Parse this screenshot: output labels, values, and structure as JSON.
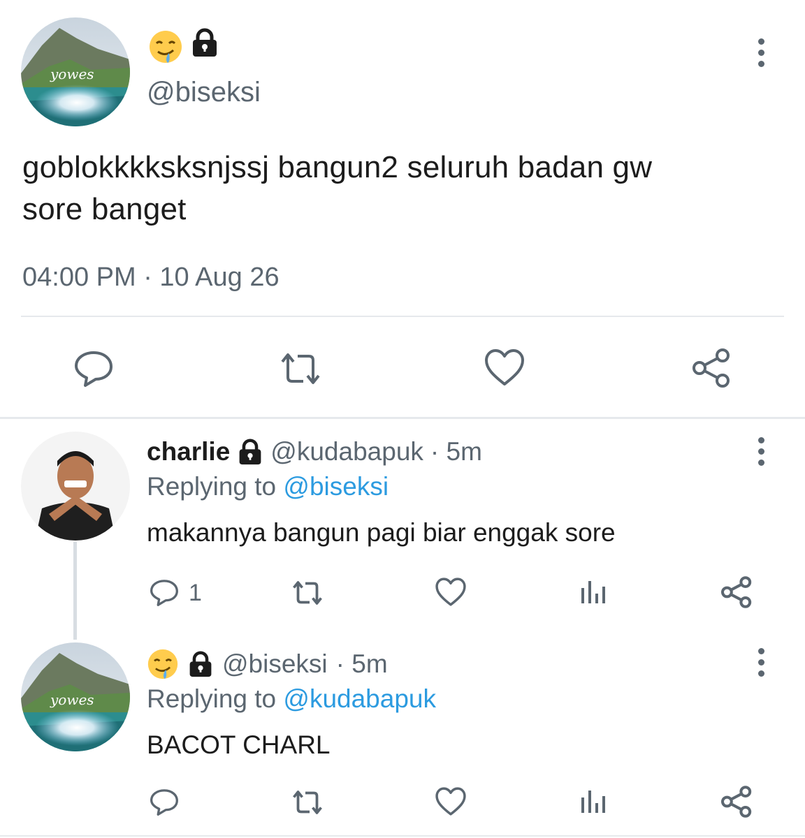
{
  "main_tweet": {
    "avatar_text": "yowes",
    "handle": "@biseksi",
    "text_line1": "goblokkkksksnjssj bangun2 seluruh badan gw",
    "text_line2": "sore banget",
    "timestamp": "04:00 PM · 10 Aug 26",
    "emoji_icon": "drooling-face-icon",
    "lock_icon": "lock-icon"
  },
  "replies": [
    {
      "name": "charlie",
      "handle": "@kudabapuk",
      "time": "· 5m",
      "replying_prefix": "Replying to",
      "replying_to": "@biseksi",
      "text": "makannya bangun pagi biar enggak sore",
      "reply_count": "1"
    },
    {
      "name": "",
      "handle": "@biseksi",
      "time": "· 5m",
      "replying_prefix": "Replying to",
      "replying_to": "@kudabapuk",
      "text": "BACOT CHARL",
      "reply_count": "",
      "avatar_text": "yowes"
    }
  ],
  "colors": {
    "text": "#1c1c1c",
    "muted": "#5b6670",
    "link": "#2c9be0",
    "divider": "#e6e9ec"
  }
}
